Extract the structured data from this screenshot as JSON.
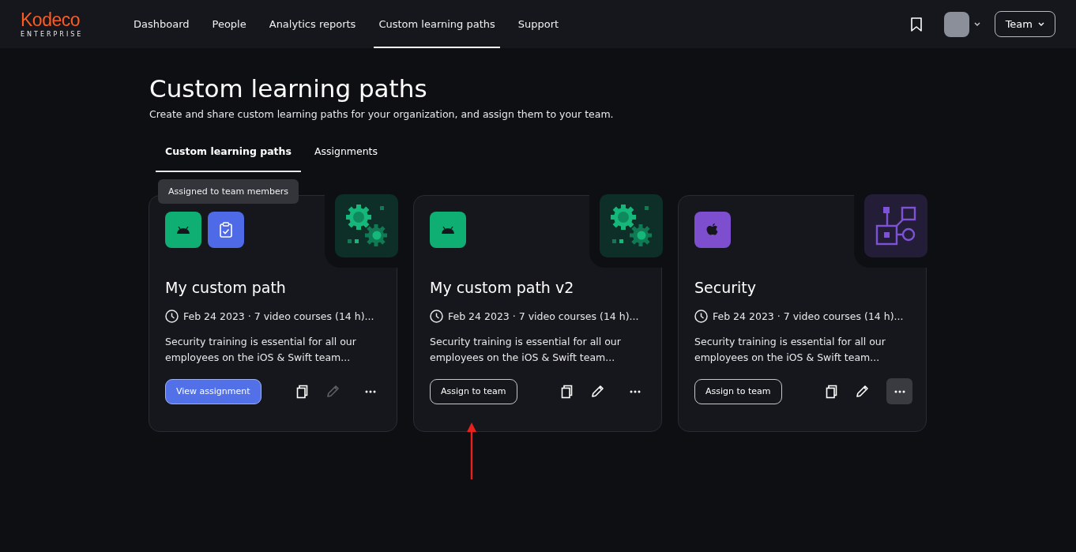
{
  "brand": {
    "name": "Kodeco",
    "subtitle": "ENTERPRISE"
  },
  "nav": [
    {
      "label": "Dashboard",
      "selected": false
    },
    {
      "label": "People",
      "selected": false
    },
    {
      "label": "Analytics reports",
      "selected": false
    },
    {
      "label": "Custom learning paths",
      "selected": true
    },
    {
      "label": "Support",
      "selected": false
    }
  ],
  "team_menu": {
    "label": "Team"
  },
  "page": {
    "title": "Custom learning paths",
    "subtitle": "Create and share custom learning paths for your organization, and  assign them to your team."
  },
  "tabs": [
    {
      "label": "Custom learning paths",
      "selected": true
    },
    {
      "label": "Assignments",
      "selected": false
    }
  ],
  "cards": [
    {
      "title": "My custom path",
      "meta": "Feb 24 2023 · 7 video courses (14 h)...",
      "description": "Security training is essential for all our employees on the iOS & Swift team...",
      "badges": [
        {
          "kind": "android"
        },
        {
          "kind": "clipboard"
        }
      ],
      "illustration": {
        "kind": "gears"
      },
      "tooltip": "Assigned to team members",
      "button": {
        "label": "View assignment",
        "kind": "primary"
      },
      "edit_disabled": true,
      "more_selected": false
    },
    {
      "title": "My custom path v2",
      "meta": "Feb 24 2023 · 7 video courses (14 h)...",
      "description": "Security training is essential for all our employees on the iOS & Swift team...",
      "badges": [
        {
          "kind": "android"
        }
      ],
      "illustration": {
        "kind": "gears"
      },
      "button": {
        "label": "Assign to team",
        "kind": "outline"
      },
      "edit_disabled": false,
      "more_selected": false
    },
    {
      "title": "Security",
      "meta": "Feb 24 2023 · 7 video courses (14 h)...",
      "description": "Security training is essential for all our employees on the iOS & Swift team...",
      "badges": [
        {
          "kind": "apple"
        }
      ],
      "illustration": {
        "kind": "diagram"
      },
      "button": {
        "label": "Assign to team",
        "kind": "outline"
      },
      "edit_disabled": false,
      "more_selected": true
    }
  ]
}
